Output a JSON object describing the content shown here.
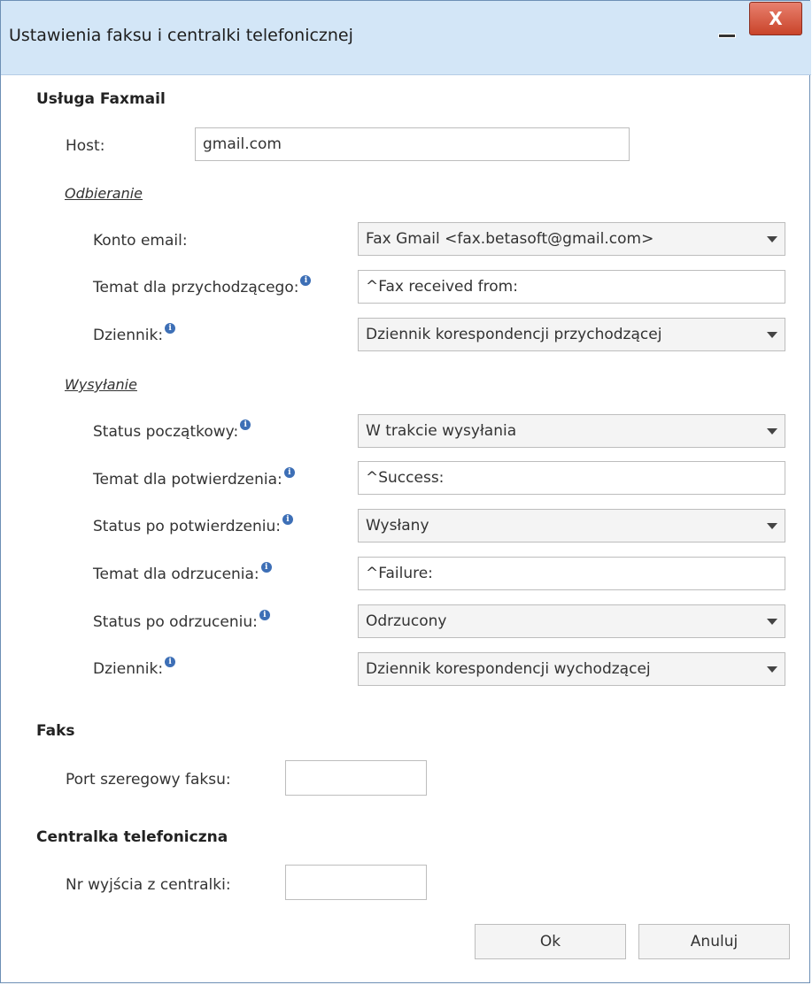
{
  "window": {
    "title": "Ustawienia faksu i centralki telefonicznej",
    "close_label": "X"
  },
  "faxmail": {
    "title": "Usługa Faxmail",
    "host_label": "Host:",
    "host_value": "gmail.com",
    "receiving": {
      "title": "Odbieranie",
      "account_label": "Konto email:",
      "account_value": "Fax Gmail <fax.betasoft@gmail.com>",
      "incoming_subject_label": "Temat dla przychodzącego:",
      "incoming_subject_value": "^Fax received from:",
      "journal_label": "Dziennik:",
      "journal_value": "Dziennik korespondencji przychodzącej"
    },
    "sending": {
      "title": "Wysyłanie",
      "initial_status_label": "Status początkowy:",
      "initial_status_value": "W trakcie wysyłania",
      "confirm_subject_label": "Temat dla potwierdzenia:",
      "confirm_subject_value": "^Success:",
      "status_after_confirm_label": "Status po potwierdzeniu:",
      "status_after_confirm_value": "Wysłany",
      "reject_subject_label": "Temat dla odrzucenia:",
      "reject_subject_value": "^Failure:",
      "status_after_reject_label": "Status po odrzuceniu:",
      "status_after_reject_value": "Odrzucony",
      "journal_label": "Dziennik:",
      "journal_value": "Dziennik korespondencji wychodzącej"
    }
  },
  "fax": {
    "title": "Faks",
    "serial_port_label": "Port szeregowy faksu:",
    "serial_port_value": ""
  },
  "pbx": {
    "title": "Centralka telefoniczna",
    "exit_number_label": "Nr wyjścia z centralki:",
    "exit_number_value": ""
  },
  "buttons": {
    "ok": "Ok",
    "cancel": "Anuluj"
  },
  "colors": {
    "titlebar": "#d3e6f7",
    "close_button": "#c9442a",
    "info_icon": "#3d6fb6"
  }
}
